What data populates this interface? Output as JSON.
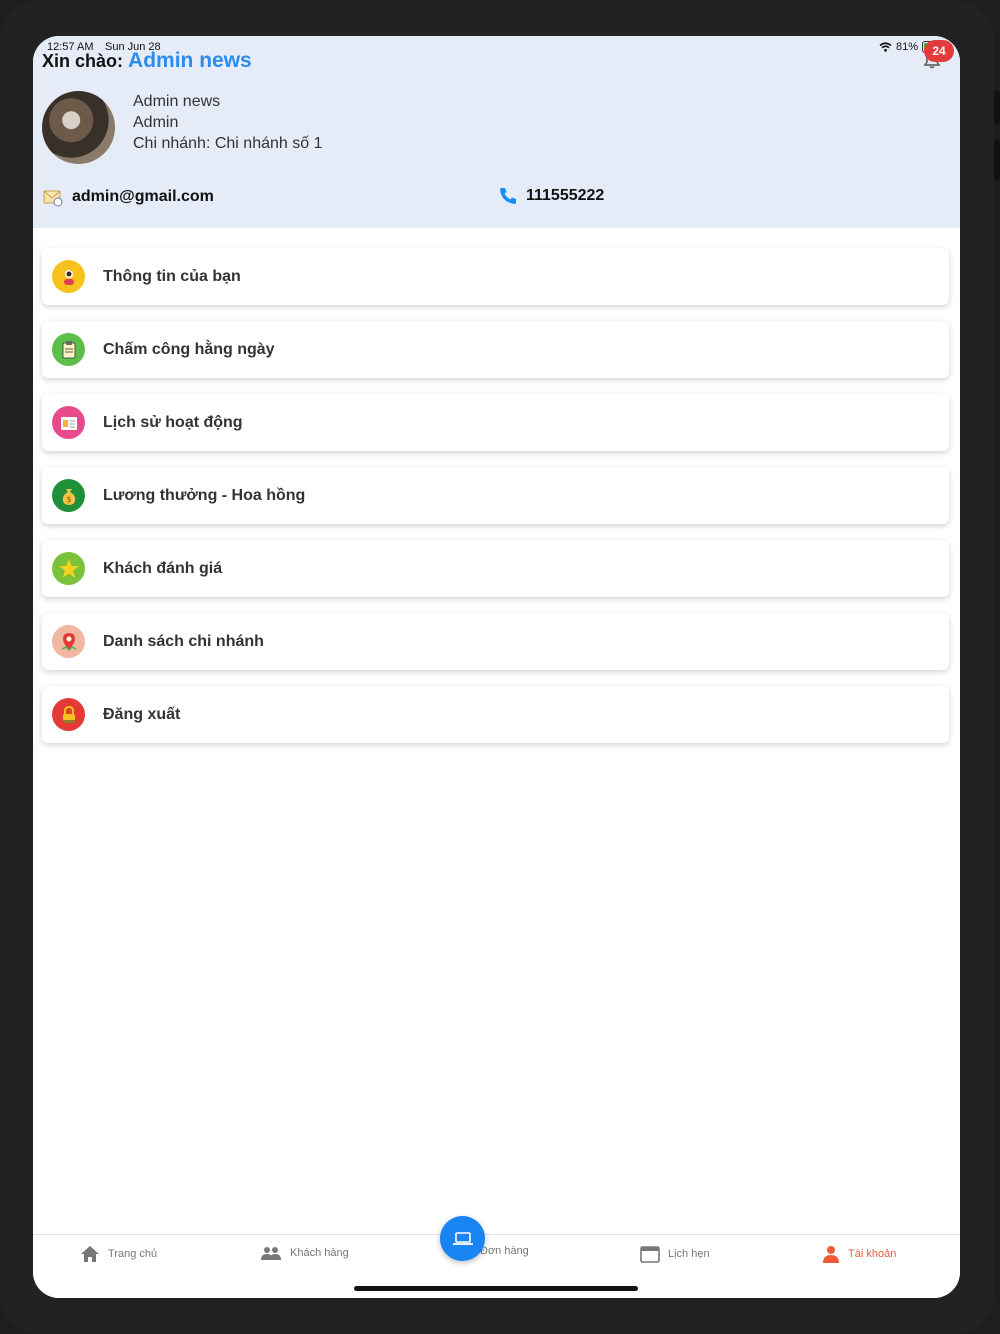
{
  "status_bar": {
    "time": "12:57 AM",
    "date": "Sun Jun 28",
    "battery": "81%"
  },
  "header": {
    "greeting_prefix": "Xin chào:",
    "greeting_name": "Admin news",
    "notification_count": "24",
    "profile": {
      "name": "Admin news",
      "role": "Admin",
      "branch": "Chi nhánh: Chi nhánh số 1"
    },
    "email": "admin@gmail.com",
    "phone": "111555222"
  },
  "menu": {
    "items": [
      {
        "label": "Thông tin của bạn",
        "icon": "user-info-icon",
        "color": "#f7c21d"
      },
      {
        "label": "Chấm công hằng ngày",
        "icon": "clipboard-icon",
        "color": "#5cbf4a"
      },
      {
        "label": "Lịch sử hoạt động",
        "icon": "history-icon",
        "color": "#e84a8c"
      },
      {
        "label": "Lương thưởng - Hoa hồng",
        "icon": "money-bag-icon",
        "color": "#1f8f3a"
      },
      {
        "label": "Khách đánh giá",
        "icon": "star-icon",
        "color": "#7ac23a"
      },
      {
        "label": "Danh sách chi nhánh",
        "icon": "map-pin-icon",
        "color": "#f1b7a2"
      },
      {
        "label": "Đăng xuất",
        "icon": "lock-icon",
        "color": "#e53935"
      }
    ]
  },
  "bottom_nav": {
    "items": [
      {
        "label": "Trang chủ",
        "icon": "home-icon"
      },
      {
        "label": "Khách hàng",
        "icon": "people-icon"
      },
      {
        "label": "Đơn hàng",
        "icon": "laptop-icon"
      },
      {
        "label": "Lịch hẹn",
        "icon": "calendar-icon"
      },
      {
        "label": "Tài khoản",
        "icon": "person-icon",
        "active": true
      }
    ]
  },
  "colors": {
    "accent": "#2a8cf0",
    "active_tab": "#f05a3a",
    "header_bg": "#e6ebf8"
  }
}
